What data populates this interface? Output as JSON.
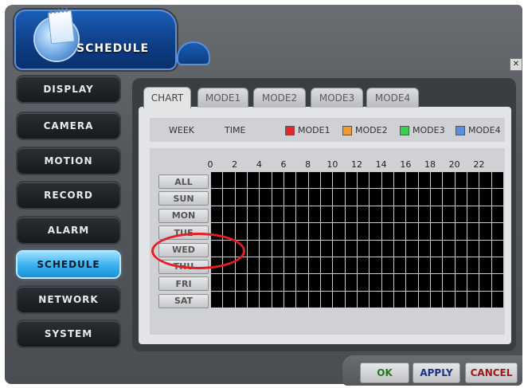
{
  "header": {
    "title": "SCHEDULE",
    "close_glyph": "✕"
  },
  "sidebar": {
    "items": [
      {
        "label": "DISPLAY",
        "active": false
      },
      {
        "label": "CAMERA",
        "active": false
      },
      {
        "label": "MOTION",
        "active": false
      },
      {
        "label": "RECORD",
        "active": false
      },
      {
        "label": "ALARM",
        "active": false
      },
      {
        "label": "SCHEDULE",
        "active": true
      },
      {
        "label": "NETWORK",
        "active": false
      },
      {
        "label": "SYSTEM",
        "active": false
      }
    ]
  },
  "tabs": [
    {
      "label": "CHART",
      "active": true
    },
    {
      "label": "MODE1",
      "active": false
    },
    {
      "label": "MODE2",
      "active": false
    },
    {
      "label": "MODE3",
      "active": false
    },
    {
      "label": "MODE4",
      "active": false
    }
  ],
  "legend": {
    "week_label": "WEEK",
    "time_label": "TIME",
    "modes": [
      {
        "label": "MODE1",
        "color": "#e0292b"
      },
      {
        "label": "MODE2",
        "color": "#f39a2c"
      },
      {
        "label": "MODE3",
        "color": "#38d04a"
      },
      {
        "label": "MODE4",
        "color": "#5b8de0"
      }
    ]
  },
  "schedule": {
    "all_label": "ALL",
    "hour_labels": [
      "0",
      "2",
      "4",
      "6",
      "8",
      "10",
      "12",
      "14",
      "16",
      "18",
      "20",
      "22"
    ],
    "days": [
      "SUN",
      "MON",
      "TUE",
      "WED",
      "THU",
      "FRI",
      "SAT"
    ],
    "grid_color": "#000000",
    "grid_line_color": "#c8cacc"
  },
  "buttons": {
    "ok": "OK",
    "apply": "APPLY",
    "cancel": "CANCEL"
  },
  "colors": {
    "ok": "#1e7a1e",
    "apply": "#1b2f8f",
    "cancel": "#a01818",
    "highlight": "#e41e22"
  }
}
